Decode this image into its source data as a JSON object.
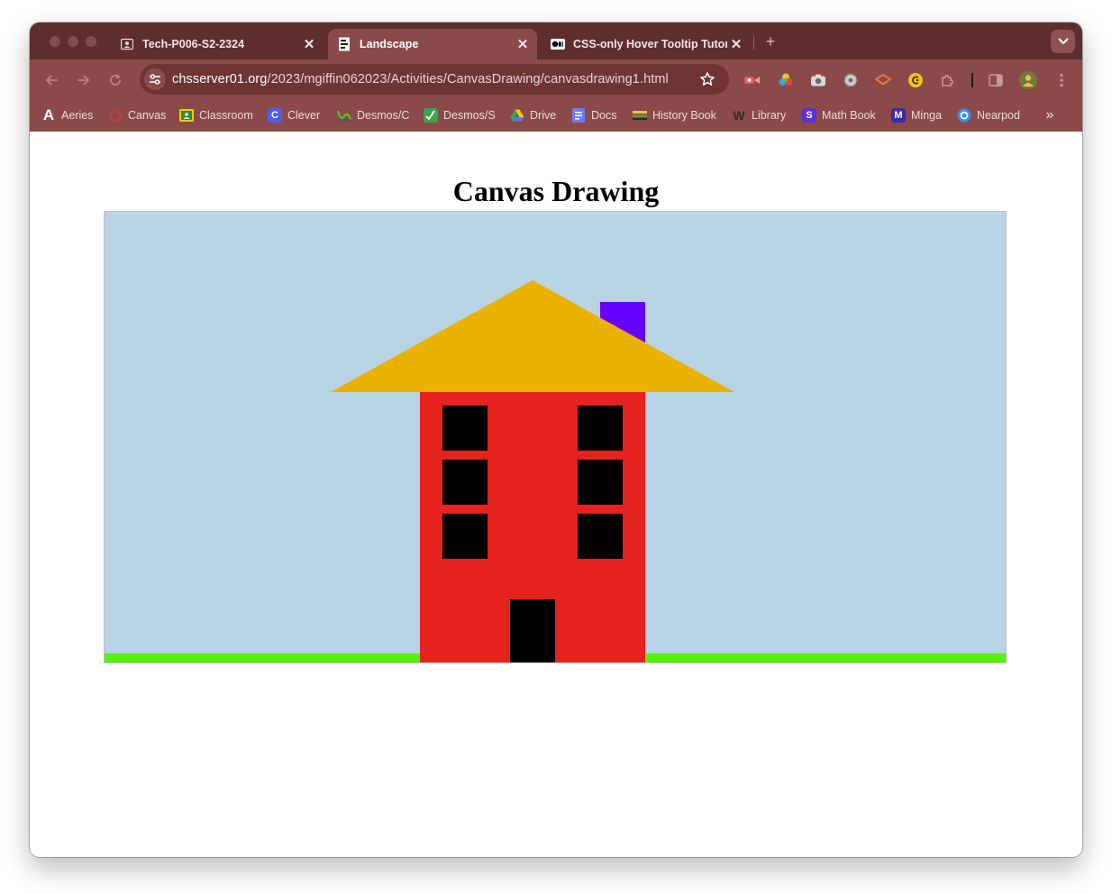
{
  "browser": {
    "tabs": [
      {
        "title": "Tech-P006-S2-2324",
        "active": false,
        "icon": "classroom-icon"
      },
      {
        "title": "Landscape",
        "active": true,
        "icon": "page-icon"
      },
      {
        "title": "CSS-only Hover Tooltip Tutori",
        "active": false,
        "icon": "medium-icon"
      }
    ],
    "url": {
      "host": "chsserver01.org",
      "path": "/2023/mgiffin062023/Activities/CanvasDrawing/canvasdrawing1.html"
    },
    "bookmarks": [
      {
        "label": "Aeries",
        "icon": "aeries-icon",
        "color": "#2a4bd7",
        "glyph": "A"
      },
      {
        "label": "Canvas",
        "icon": "canvas-icon",
        "color": "#e13b2e",
        "glyph": ""
      },
      {
        "label": "Classroom",
        "icon": "classroom-icon",
        "color": "#f9c80e",
        "glyph": ""
      },
      {
        "label": "Clever",
        "icon": "clever-icon",
        "color": "#4f5cf0",
        "glyph": "C"
      },
      {
        "label": "Desmos/C",
        "icon": "desmos-icon",
        "color": "#2f9e44",
        "glyph": ""
      },
      {
        "label": "Desmos/S",
        "icon": "desmos-scientific-icon",
        "color": "#3fa356",
        "glyph": ""
      },
      {
        "label": "Drive",
        "icon": "drive-icon",
        "color": "#34a853",
        "glyph": ""
      },
      {
        "label": "Docs",
        "icon": "docs-icon",
        "color": "#4285f4",
        "glyph": ""
      },
      {
        "label": "History Book",
        "icon": "history-book-icon",
        "color": "#4f9a3a",
        "glyph": ""
      },
      {
        "label": "Library",
        "icon": "library-icon",
        "color": "#3d3d3d",
        "glyph": "W"
      },
      {
        "label": "Math Book",
        "icon": "math-book-icon",
        "color": "#5b2fd6",
        "glyph": "S"
      },
      {
        "label": "Minga",
        "icon": "minga-icon",
        "color": "#3b2aa8",
        "glyph": "M"
      },
      {
        "label": "Nearpod",
        "icon": "nearpod-icon",
        "color": "#3a8ef0",
        "glyph": ""
      }
    ]
  },
  "page": {
    "heading": "Canvas Drawing"
  },
  "scene": {
    "sky_color": "#b9d4e6",
    "grass_color": "#55f20a",
    "roof_color": "#e9b200",
    "chimney_color": "#6600ff",
    "wall_color": "#e5221d",
    "window_color": "#000000",
    "door_color": "#000000"
  }
}
